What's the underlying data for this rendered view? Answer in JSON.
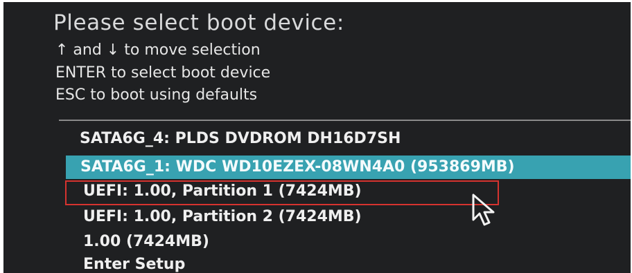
{
  "title": "Please select boot device:",
  "help": [
    "↑ and ↓ to move selection",
    "ENTER to select boot device",
    "ESC to boot using defaults"
  ],
  "menu": {
    "selected_index": 1,
    "items": [
      "SATA6G_4: PLDS DVDROM DH16D7SH",
      "SATA6G_1: WDC WD10EZEX-08WN4A0  (953869MB)",
      "UEFI: 1.00, Partition 1 (7424MB)",
      "UEFI: 1.00, Partition 2 (7424MB)",
      "1.00  (7424MB)",
      "Enter Setup"
    ]
  },
  "colors": {
    "background": "#1f2022",
    "highlight": "#38a2b1",
    "annotation_box": "#d6332f"
  },
  "icons": {
    "pointer": "mouse-cursor-icon"
  }
}
